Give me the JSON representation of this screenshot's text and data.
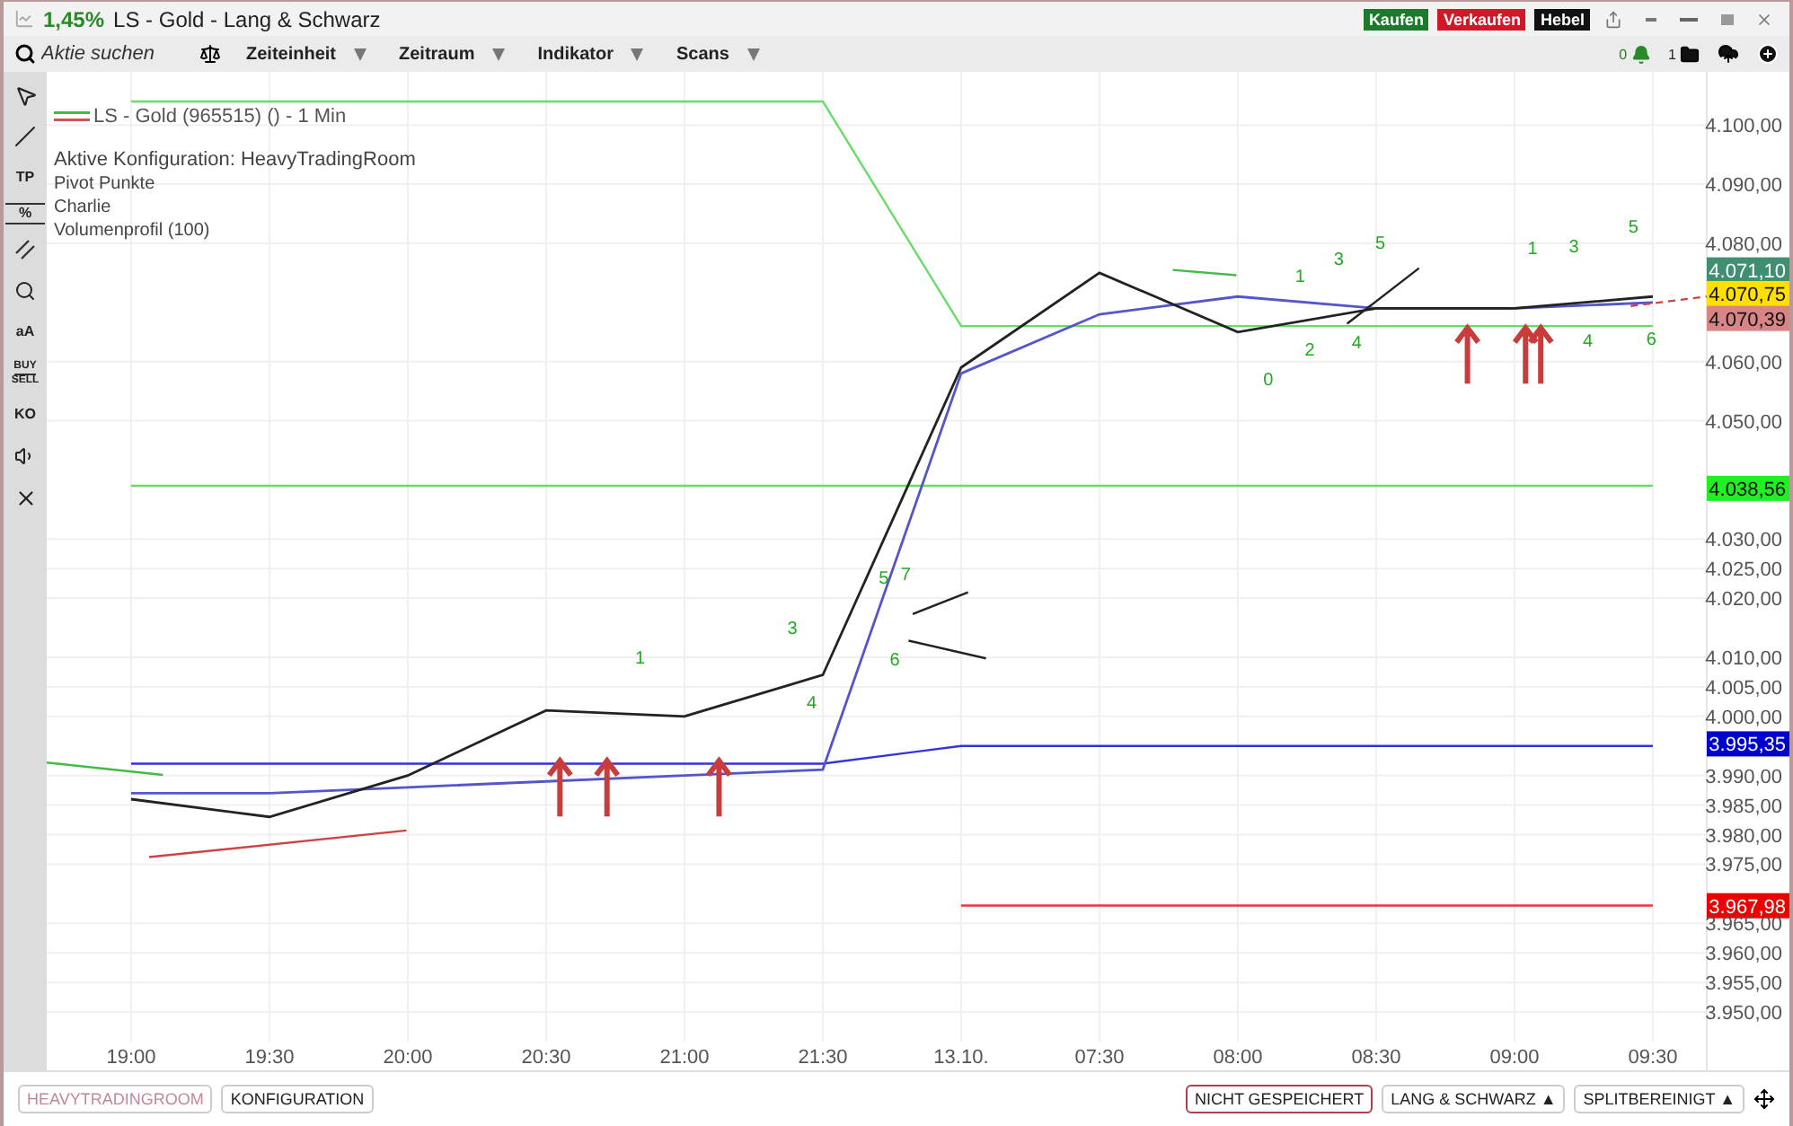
{
  "title_bar": {
    "change": "1,45%",
    "title": "LS - Gold - Lang & Schwarz",
    "buttons": [
      {
        "kind": "buy",
        "label": "Kaufen"
      },
      {
        "kind": "sell",
        "label": "Verkaufen"
      },
      {
        "kind": "lever",
        "label": "Hebel"
      }
    ]
  },
  "toolbar": {
    "search": {
      "placeholder": "Aktie suchen"
    },
    "menus": [
      "Zeiteinheit",
      "Zeitraum",
      "Indikator",
      "Scans"
    ],
    "alerts_count": "0",
    "folders_count": "1"
  },
  "tools": [
    {
      "kind": "cursor"
    },
    {
      "kind": "line"
    },
    {
      "kind": "text",
      "label": "TP"
    },
    {
      "kind": "percent",
      "label": "%"
    },
    {
      "kind": "parallel"
    },
    {
      "kind": "search"
    },
    {
      "kind": "text",
      "label": "aA"
    },
    {
      "kind": "buysell",
      "label": "BUY",
      "label2": "SELL"
    },
    {
      "kind": "text",
      "label": "KO"
    },
    {
      "kind": "sound"
    },
    {
      "kind": "close"
    }
  ],
  "legend": {
    "instrument": "LS - Gold (965515) () - 1 Min",
    "configuration": "Aktive Konfiguration: HeavyTradingRoom",
    "indicators": [
      "Pivot Punkte",
      "Charlie",
      "Volumenprofil (100)"
    ]
  },
  "chart": {
    "chart_data": {
      "type": "line",
      "grid": true,
      "categories": [
        "19:00",
        "19:30",
        "20:00",
        "20:30",
        "21:00",
        "21:30",
        "13.10.",
        "07:30",
        "08:00",
        "08:30",
        "09:00",
        "09:30"
      ],
      "ylim": [
        3945,
        4109
      ],
      "yticks": [
        {
          "value": 4100,
          "label": "4.100,00"
        },
        {
          "value": 4090,
          "label": "4.090,00"
        },
        {
          "value": 4080,
          "label": "4.080,00"
        },
        {
          "value": 4060,
          "label": "4.060,00"
        },
        {
          "value": 4050,
          "label": "4.050,00"
        },
        {
          "value": 4030,
          "label": "4.030,00"
        },
        {
          "value": 4025,
          "label": "4.025,00"
        },
        {
          "value": 4020,
          "label": "4.020,00"
        },
        {
          "value": 4010,
          "label": "4.010,00"
        },
        {
          "value": 4005,
          "label": "4.005,00"
        },
        {
          "value": 4000,
          "label": "4.000,00"
        },
        {
          "value": 3990,
          "label": "3.990,00"
        },
        {
          "value": 3985,
          "label": "3.985,00"
        },
        {
          "value": 3980,
          "label": "3.980,00"
        },
        {
          "value": 3975,
          "label": "3.975,00"
        },
        {
          "value": 3965,
          "label": "3.965,00"
        },
        {
          "value": 3960,
          "label": "3.960,00"
        },
        {
          "value": 3955,
          "label": "3.955,00"
        },
        {
          "value": 3950,
          "label": "3.950,00"
        }
      ],
      "series": [
        {
          "color": "#66dd66",
          "values": [
            4104,
            4104,
            4104,
            4104,
            4104,
            4104,
            4066,
            4066,
            4066,
            4066,
            4066,
            4066
          ]
        },
        {
          "color": "#66dd66",
          "values": [
            4039,
            4039,
            4039,
            4039,
            4039,
            4039,
            4039,
            4039,
            4039,
            4039,
            4039,
            4039
          ]
        },
        {
          "color": "#3333dd",
          "values": [
            3992,
            3992,
            3992,
            3992,
            3992,
            3992,
            3995,
            3995,
            3995,
            3995,
            3995,
            3995
          ]
        },
        {
          "color": "#ee3333",
          "values": [
            null,
            null,
            null,
            null,
            null,
            null,
            3968,
            3968,
            3968,
            3968,
            3968,
            3968
          ]
        },
        {
          "color": "#5555cc",
          "values": [
            3987,
            3987,
            3988,
            3989,
            3990,
            3991,
            4058,
            4068,
            4071,
            4069,
            4069,
            4070
          ]
        },
        {
          "color": "#222222",
          "values": [
            3986,
            3983,
            3990,
            4001,
            4000,
            4007,
            4059,
            4075,
            4065,
            4069,
            4069,
            4071
          ]
        }
      ]
    }
  },
  "wave_labels": [
    "1",
    "3",
    "4",
    "5",
    "7",
    "6",
    "0",
    "1",
    "2",
    "3",
    "5",
    "4",
    "1",
    "3",
    "4",
    "5",
    "6"
  ],
  "price_tags": [
    {
      "text": "4.071,10",
      "color": "#3f8f70"
    },
    {
      "text": "4.070,75",
      "color": "#ffe000"
    },
    {
      "text": "4.070,39",
      "color": "#d98585"
    },
    {
      "text": "4.038,56",
      "color": "#22ee22"
    },
    {
      "text": "3.995,35",
      "color": "#0000cc"
    },
    {
      "text": "3.967,98",
      "color": "#ee0000"
    }
  ],
  "status_bar": {
    "left": [
      {
        "label": "HEAVYTRADINGROOM",
        "muted": true
      },
      {
        "label": "KONFIGURATION",
        "muted": false
      }
    ],
    "right": [
      {
        "label": "NICHT GESPEICHERT",
        "warning": true
      },
      {
        "label": "LANG & SCHWARZ ▲",
        "warning": false
      },
      {
        "label": "SPLITBEREINIGT ▲",
        "warning": false
      }
    ]
  }
}
